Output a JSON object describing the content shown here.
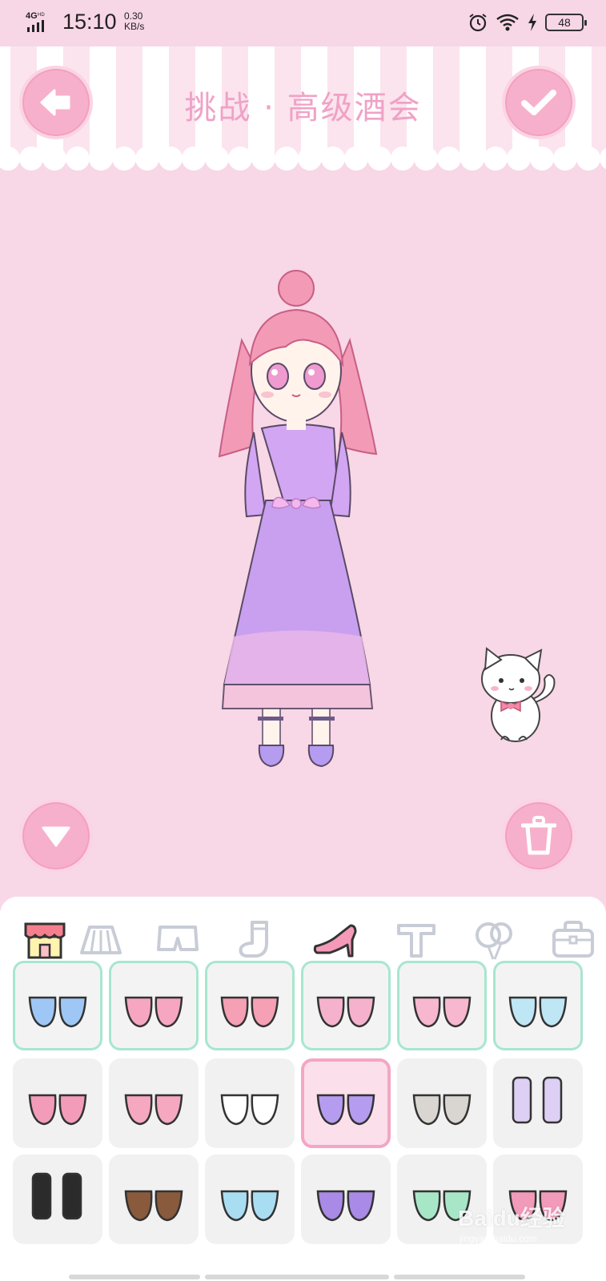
{
  "status_bar": {
    "network": "4G HD",
    "time": "15:10",
    "speed_value": "0.30",
    "speed_unit": "KB/s",
    "battery": "48",
    "icons": [
      "signal-icon",
      "alarm-icon",
      "wifi-icon",
      "charging-icon",
      "battery-icon"
    ]
  },
  "header": {
    "title": "挑战 · 高级酒会",
    "back_icon": "back-arrow-icon",
    "confirm_icon": "checkmark-icon"
  },
  "stage": {
    "character": "girl-in-lavender-dress",
    "pet": "white-cat-with-pink-bow",
    "collapse_icon": "triangle-down-icon",
    "delete_icon": "trash-icon"
  },
  "tabs": [
    {
      "name": "shop",
      "icon": "shop-icon",
      "selected": false
    },
    {
      "name": "skirt",
      "icon": "skirt-icon",
      "selected": false
    },
    {
      "name": "shorts",
      "icon": "shorts-icon",
      "selected": false
    },
    {
      "name": "socks",
      "icon": "sock-icon",
      "selected": false
    },
    {
      "name": "shoes",
      "icon": "high-heel-icon",
      "selected": true
    },
    {
      "name": "top",
      "icon": "tshirt-icon",
      "selected": false
    },
    {
      "name": "balloon",
      "icon": "balloon-icon",
      "selected": false
    },
    {
      "name": "bag",
      "icon": "bag-icon",
      "selected": false
    }
  ],
  "shoe_items": [
    {
      "row": 0,
      "col": 0,
      "kind": "sneakers-blue",
      "owned": true
    },
    {
      "row": 0,
      "col": 1,
      "kind": "flats-pink-bow",
      "owned": true
    },
    {
      "row": 0,
      "col": 2,
      "kind": "strawberry-shoes",
      "owned": true
    },
    {
      "row": 0,
      "col": 3,
      "kind": "mary-janes-pink",
      "owned": true
    },
    {
      "row": 0,
      "col": 4,
      "kind": "ballet-pink",
      "owned": true
    },
    {
      "row": 0,
      "col": 5,
      "kind": "bunny-slippers-blue",
      "owned": true
    },
    {
      "row": 1,
      "col": 0,
      "kind": "strap-shoes-pink",
      "owned": false
    },
    {
      "row": 1,
      "col": 1,
      "kind": "pig-slippers",
      "owned": false
    },
    {
      "row": 1,
      "col": 2,
      "kind": "lace-up-flats-white",
      "owned": false
    },
    {
      "row": 1,
      "col": 3,
      "kind": "purple-pumps",
      "owned": false,
      "selected": true
    },
    {
      "row": 1,
      "col": 4,
      "kind": "sneakers-grey",
      "owned": false
    },
    {
      "row": 1,
      "col": 5,
      "kind": "lace-boots-lilac",
      "owned": false
    },
    {
      "row": 2,
      "col": 0,
      "kind": "boots-black",
      "owned": false
    },
    {
      "row": 2,
      "col": 1,
      "kind": "loafers-brown",
      "owned": false
    },
    {
      "row": 2,
      "col": 2,
      "kind": "fluffy-slippers-blue",
      "owned": false
    },
    {
      "row": 2,
      "col": 3,
      "kind": "pompom-shoes-purple",
      "owned": false
    },
    {
      "row": 2,
      "col": 4,
      "kind": "pompom-shoes-mint",
      "owned": false
    },
    {
      "row": 2,
      "col": 5,
      "kind": "shoes-pink",
      "owned": false
    }
  ],
  "watermark": {
    "brand": "Baidu经验",
    "url": "jingyan.baidu.com"
  },
  "colors": {
    "background": "#f8d7e6",
    "accent_pink": "#f4a6c4",
    "owned_border": "#a8e6cf",
    "title": "#f0a2c6"
  }
}
